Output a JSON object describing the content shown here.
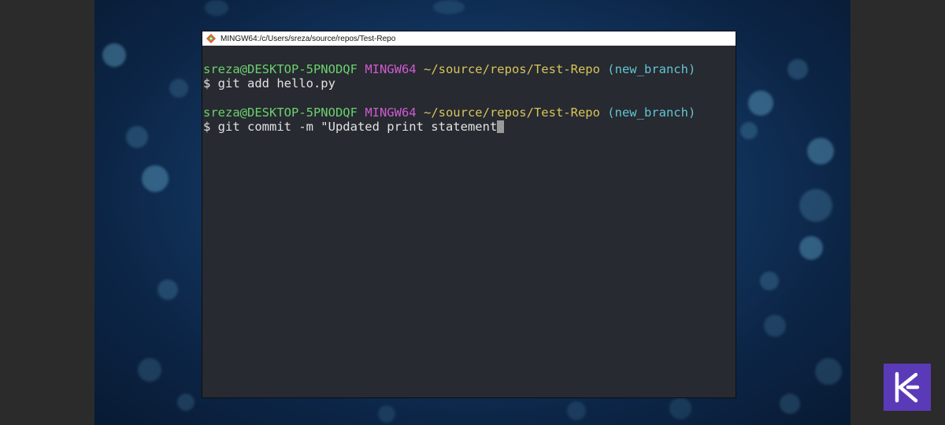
{
  "window": {
    "title": "MINGW64:/c/Users/sreza/source/repos/Test-Repo"
  },
  "terminal": {
    "prompt1": {
      "user_host": "sreza@DESKTOP-5PNODQF",
      "env": "MINGW64",
      "path": "~/source/repos/Test-Repo",
      "branch": "(new_branch)"
    },
    "command1": "$ git add hello.py",
    "prompt2": {
      "user_host": "sreza@DESKTOP-5PNODQF",
      "env": "MINGW64",
      "path": "~/source/repos/Test-Repo",
      "branch": "(new_branch)"
    },
    "command2": "$ git commit -m \"Updated print statement"
  },
  "colors": {
    "user_host": "#6bd16f",
    "env": "#d05ad2",
    "path": "#d8c45c",
    "branch": "#62c3d3",
    "terminal_bg": "#272a30",
    "logo_bg": "#5b3ab8"
  },
  "icons": {
    "title_icon": "git-bash-icon",
    "logo": "k-logo"
  }
}
